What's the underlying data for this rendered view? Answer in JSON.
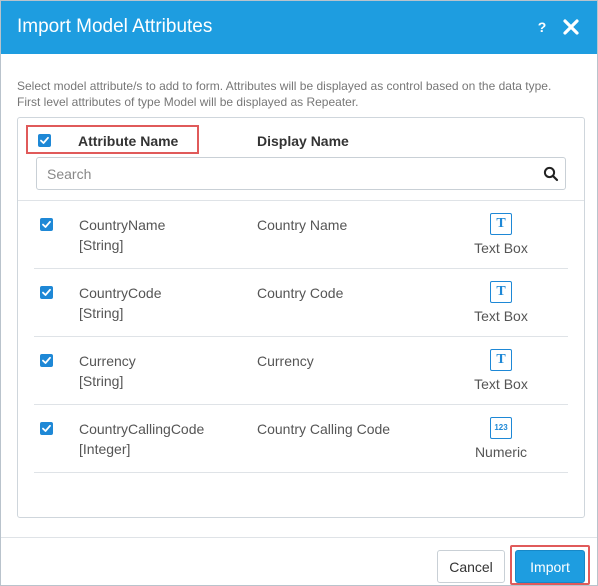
{
  "dialog": {
    "title": "Import Model Attributes",
    "help_icon": "help-icon",
    "close_icon": "close-icon",
    "description_line1": "Select model attribute/s to add to form. Attributes will be displayed as control based on the data type.",
    "description_line2": "First level attributes of type Model will be displayed as Repeater."
  },
  "table": {
    "header": {
      "select_all_checked": true,
      "attribute_name": "Attribute Name",
      "display_name": "Display Name"
    },
    "search": {
      "placeholder": "Search",
      "value": ""
    },
    "rows": [
      {
        "checked": true,
        "attribute": "CountryName",
        "type": "[String]",
        "display": "Country Name",
        "control_glyph": "T",
        "control_label": "Text Box"
      },
      {
        "checked": true,
        "attribute": "CountryCode",
        "type": "[String]",
        "display": "Country Code",
        "control_glyph": "T",
        "control_label": "Text Box"
      },
      {
        "checked": true,
        "attribute": "Currency",
        "type": "[String]",
        "display": "Currency",
        "control_glyph": "T",
        "control_label": "Text Box"
      },
      {
        "checked": true,
        "attribute": "CountryCallingCode",
        "type": "[Integer]",
        "display": "Country Calling Code",
        "control_glyph": "123",
        "control_label": "Numeric"
      }
    ]
  },
  "footer": {
    "cancel_label": "Cancel",
    "import_label": "Import"
  },
  "colors": {
    "accent": "#1e9de0",
    "checkbox": "#1e88d6",
    "highlight": "#e05a5a"
  }
}
